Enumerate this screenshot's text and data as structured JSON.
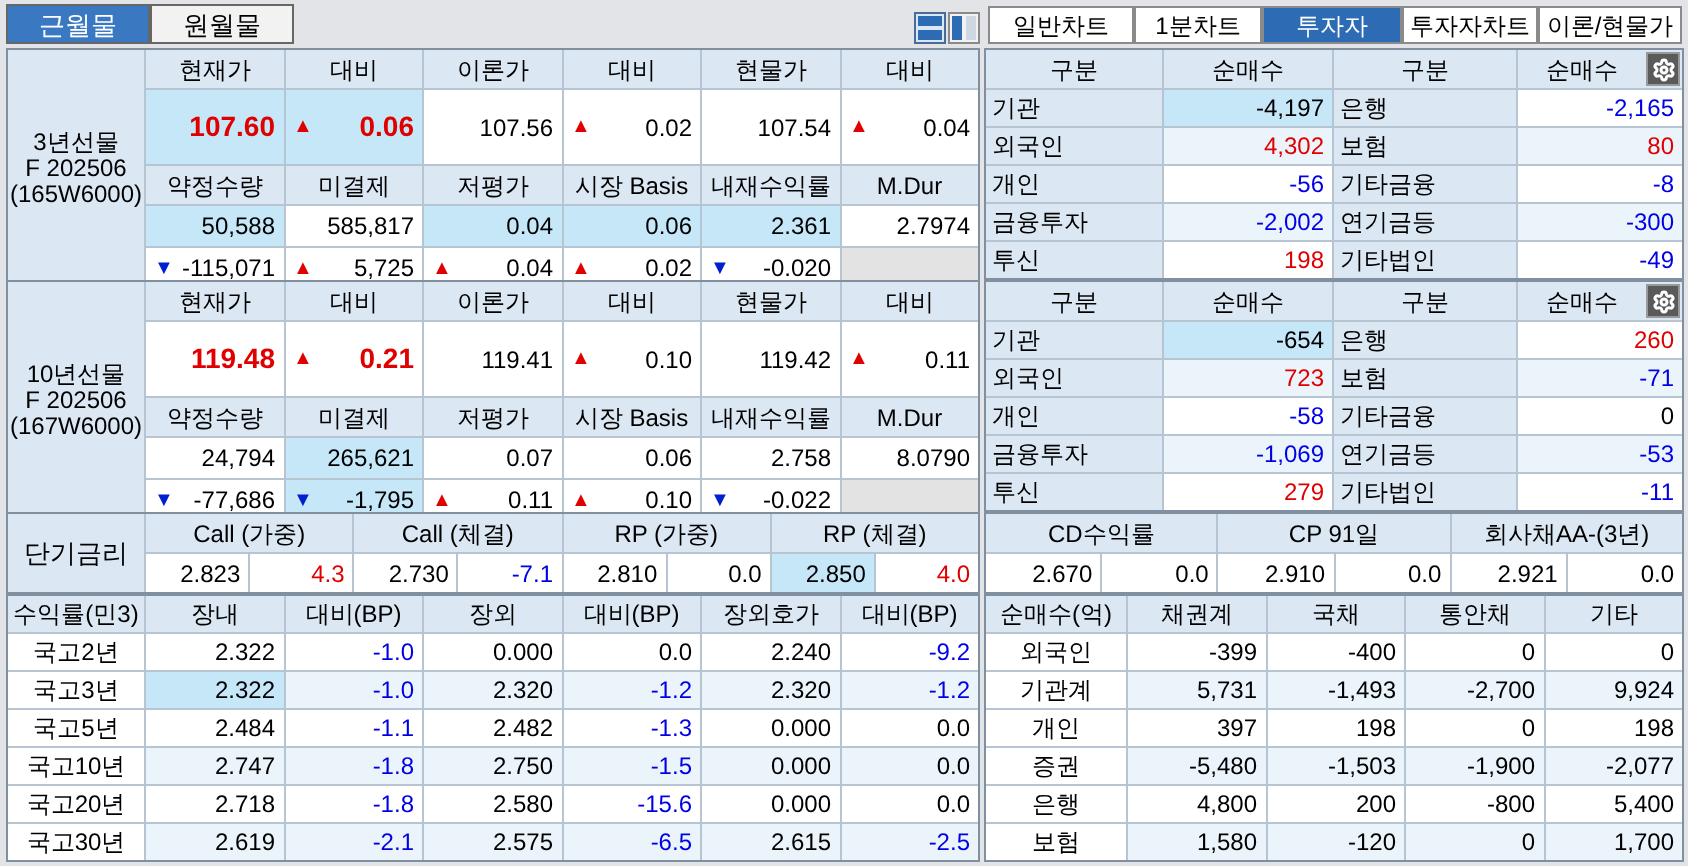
{
  "left_tabs": [
    {
      "label": "근월물",
      "selected": true
    },
    {
      "label": "원월물",
      "selected": false
    }
  ],
  "right_tabs": [
    {
      "label": "일반차트",
      "selected": false
    },
    {
      "label": "1분차트",
      "selected": false
    },
    {
      "label": "투자자",
      "selected": true
    },
    {
      "label": "투자자차트",
      "selected": false
    },
    {
      "label": "이론/현물가",
      "selected": false
    }
  ],
  "futures": [
    {
      "name": "3년선물",
      "code": "F 202506",
      "symbol": "(165W6000)",
      "top_headers": [
        "현재가",
        "대비",
        "이론가",
        "대비",
        "현물가",
        "대비"
      ],
      "top_values": [
        {
          "text": "107.60",
          "color": "#e00000",
          "highlighted": true
        },
        {
          "text": "0.06",
          "color": "#e00000",
          "arrow": {
            "text": "▲",
            "color": "#e00000"
          },
          "highlighted": true
        },
        {
          "text": "107.56"
        },
        {
          "text": "0.02",
          "arrow": {
            "text": "▲",
            "color": "#e00000"
          }
        },
        {
          "text": "107.54"
        },
        {
          "text": "0.04",
          "arrow": {
            "text": "▲",
            "color": "#e00000"
          }
        }
      ],
      "bottom_headers": [
        "약정수량",
        "미결제",
        "저평가",
        "시장 Basis",
        "내재수익률",
        "M.Dur"
      ],
      "bottom_values": [
        {
          "text": "50,588",
          "highlighted": true
        },
        {
          "text": "585,817"
        },
        {
          "text": "0.04",
          "highlighted": true
        },
        {
          "text": "0.06",
          "highlighted": true
        },
        {
          "text": "2.361",
          "highlighted": true
        },
        {
          "text": "2.7974"
        }
      ],
      "changes": [
        {
          "text": "-115,071",
          "arrow": {
            "text": "▼",
            "color": "#0020d0"
          }
        },
        {
          "text": "5,725",
          "arrow": {
            "text": "▲",
            "color": "#e00000"
          }
        },
        {
          "text": "0.04",
          "arrow": {
            "text": "▲",
            "color": "#e00000"
          }
        },
        {
          "text": "0.02",
          "arrow": {
            "text": "▲",
            "color": "#e00000"
          }
        },
        {
          "text": "-0.020",
          "arrow": {
            "text": "▼",
            "color": "#0020d0"
          }
        }
      ]
    },
    {
      "name": "10년선물",
      "code": "F 202506",
      "symbol": "(167W6000)",
      "top_headers": [
        "현재가",
        "대비",
        "이론가",
        "대비",
        "현물가",
        "대비"
      ],
      "top_values": [
        {
          "text": "119.48",
          "color": "#e00000"
        },
        {
          "text": "0.21",
          "color": "#e00000",
          "arrow": {
            "text": "▲",
            "color": "#e00000"
          }
        },
        {
          "text": "119.41"
        },
        {
          "text": "0.10",
          "arrow": {
            "text": "▲",
            "color": "#e00000"
          }
        },
        {
          "text": "119.42"
        },
        {
          "text": "0.11",
          "arrow": {
            "text": "▲",
            "color": "#e00000"
          }
        }
      ],
      "bottom_headers": [
        "약정수량",
        "미결제",
        "저평가",
        "시장 Basis",
        "내재수익률",
        "M.Dur"
      ],
      "bottom_values": [
        {
          "text": "24,794"
        },
        {
          "text": "265,621",
          "highlighted": true
        },
        {
          "text": "0.07"
        },
        {
          "text": "0.06"
        },
        {
          "text": "2.758"
        },
        {
          "text": "8.0790"
        }
      ],
      "changes": [
        {
          "text": "-77,686",
          "arrow": {
            "text": "▼",
            "color": "#0020d0"
          }
        },
        {
          "text": "-1,795",
          "arrow": {
            "text": "▼",
            "color": "#0020d0"
          },
          "highlighted": true
        },
        {
          "text": "0.11",
          "arrow": {
            "text": "▲",
            "color": "#e00000"
          }
        },
        {
          "text": "0.10",
          "arrow": {
            "text": "▲",
            "color": "#e00000"
          }
        },
        {
          "text": "-0.022",
          "arrow": {
            "text": "▼",
            "color": "#0020d0"
          }
        }
      ]
    }
  ],
  "investors": [
    {
      "headers": [
        "구분",
        "순매수",
        "구분",
        "순매수"
      ],
      "rows": [
        [
          {
            "text": "기관"
          },
          {
            "text": "-4,197",
            "highlighted": true
          },
          {
            "text": "은행"
          },
          {
            "text": "-2,165",
            "color": "#0000e6"
          }
        ],
        [
          {
            "text": "외국인"
          },
          {
            "text": "4,302",
            "color": "#e00000"
          },
          {
            "text": "보험"
          },
          {
            "text": "80",
            "color": "#e00000"
          }
        ],
        [
          {
            "text": "개인"
          },
          {
            "text": "-56",
            "color": "#0000e6"
          },
          {
            "text": "기타금융"
          },
          {
            "text": "-8",
            "color": "#0000e6"
          }
        ],
        [
          {
            "text": "금융투자"
          },
          {
            "text": "-2,002",
            "color": "#0000e6"
          },
          {
            "text": "연기금등"
          },
          {
            "text": "-300",
            "color": "#0000e6"
          }
        ],
        [
          {
            "text": "투신"
          },
          {
            "text": "198",
            "color": "#e00000"
          },
          {
            "text": "기타법인"
          },
          {
            "text": "-49",
            "color": "#0000e6"
          }
        ]
      ]
    },
    {
      "headers": [
        "구분",
        "순매수",
        "구분",
        "순매수"
      ],
      "rows": [
        [
          {
            "text": "기관"
          },
          {
            "text": "-654",
            "highlighted": true
          },
          {
            "text": "은행"
          },
          {
            "text": "260",
            "color": "#e00000"
          }
        ],
        [
          {
            "text": "외국인"
          },
          {
            "text": "723",
            "color": "#e00000"
          },
          {
            "text": "보험"
          },
          {
            "text": "-71",
            "color": "#0000e6"
          }
        ],
        [
          {
            "text": "개인"
          },
          {
            "text": "-58",
            "color": "#0000e6"
          },
          {
            "text": "기타금융"
          },
          {
            "text": "0"
          }
        ],
        [
          {
            "text": "금융투자"
          },
          {
            "text": "-1,069",
            "color": "#0000e6"
          },
          {
            "text": "연기금등"
          },
          {
            "text": "-53",
            "color": "#0000e6"
          }
        ],
        [
          {
            "text": "투신"
          },
          {
            "text": "279",
            "color": "#e00000"
          },
          {
            "text": "기타법인"
          },
          {
            "text": "-11",
            "color": "#0000e6"
          }
        ]
      ]
    }
  ],
  "short_rates": {
    "label": "단기금리",
    "items": [
      {
        "name": "Call (가중)",
        "rate": {
          "text": "2.823"
        },
        "change": {
          "text": "4.3",
          "color": "#e00000"
        }
      },
      {
        "name": "Call (체결)",
        "rate": {
          "text": "2.730"
        },
        "change": {
          "text": "-7.1",
          "color": "#0000e6"
        }
      },
      {
        "name": "RP (가중)",
        "rate": {
          "text": "2.810"
        },
        "change": {
          "text": "0.0"
        }
      },
      {
        "name": "RP (체결)",
        "rate": {
          "text": "2.850",
          "highlighted": true
        },
        "change": {
          "text": "4.0",
          "color": "#e00000"
        }
      },
      {
        "name": "CD수익률",
        "rate": {
          "text": "2.670"
        },
        "change": {
          "text": "0.0"
        }
      },
      {
        "name": "CP 91일",
        "rate": {
          "text": "2.910"
        },
        "change": {
          "text": "0.0"
        }
      },
      {
        "name": "회사채AA-(3년)",
        "rate": {
          "text": "2.921"
        },
        "change": {
          "text": "0.0"
        }
      }
    ]
  },
  "yields": {
    "headers": [
      "수익률(민3)",
      "장내",
      "대비(BP)",
      "장외",
      "대비(BP)",
      "장외호가",
      "대비(BP)"
    ],
    "rows": [
      [
        {
          "text": "국고2년"
        },
        {
          "text": "2.322"
        },
        {
          "text": "-1.0",
          "color": "#0000e6"
        },
        {
          "text": "0.000"
        },
        {
          "text": "0.0"
        },
        {
          "text": "2.240"
        },
        {
          "text": "-9.2",
          "color": "#0000e6"
        }
      ],
      [
        {
          "text": "국고3년"
        },
        {
          "text": "2.322",
          "highlighted": true
        },
        {
          "text": "-1.0",
          "color": "#0000e6"
        },
        {
          "text": "2.320"
        },
        {
          "text": "-1.2",
          "color": "#0000e6"
        },
        {
          "text": "2.320"
        },
        {
          "text": "-1.2",
          "color": "#0000e6"
        }
      ],
      [
        {
          "text": "국고5년"
        },
        {
          "text": "2.484"
        },
        {
          "text": "-1.1",
          "color": "#0000e6"
        },
        {
          "text": "2.482"
        },
        {
          "text": "-1.3",
          "color": "#0000e6"
        },
        {
          "text": "0.000"
        },
        {
          "text": "0.0"
        }
      ],
      [
        {
          "text": "국고10년"
        },
        {
          "text": "2.747"
        },
        {
          "text": "-1.8",
          "color": "#0000e6"
        },
        {
          "text": "2.750"
        },
        {
          "text": "-1.5",
          "color": "#0000e6"
        },
        {
          "text": "0.000"
        },
        {
          "text": "0.0"
        }
      ],
      [
        {
          "text": "국고20년"
        },
        {
          "text": "2.718"
        },
        {
          "text": "-1.8",
          "color": "#0000e6"
        },
        {
          "text": "2.580"
        },
        {
          "text": "-15.6",
          "color": "#0000e6"
        },
        {
          "text": "0.000"
        },
        {
          "text": "0.0"
        }
      ],
      [
        {
          "text": "국고30년"
        },
        {
          "text": "2.619"
        },
        {
          "text": "-2.1",
          "color": "#0000e6"
        },
        {
          "text": "2.575"
        },
        {
          "text": "-6.5",
          "color": "#0000e6"
        },
        {
          "text": "2.615"
        },
        {
          "text": "-2.5",
          "color": "#0000e6"
        }
      ]
    ]
  },
  "net_buying": {
    "headers": [
      "순매수(억)",
      "채권계",
      "국채",
      "통안채",
      "기타"
    ],
    "rows": [
      [
        {
          "text": "외국인"
        },
        {
          "text": "-399"
        },
        {
          "text": "-400"
        },
        {
          "text": "0"
        },
        {
          "text": "0"
        }
      ],
      [
        {
          "text": "기관계"
        },
        {
          "text": "5,731"
        },
        {
          "text": "-1,493"
        },
        {
          "text": "-2,700"
        },
        {
          "text": "9,924"
        }
      ],
      [
        {
          "text": "개인"
        },
        {
          "text": "397"
        },
        {
          "text": "198"
        },
        {
          "text": "0"
        },
        {
          "text": "198"
        }
      ],
      [
        {
          "text": "증권"
        },
        {
          "text": "-5,480"
        },
        {
          "text": "-1,503"
        },
        {
          "text": "-1,900"
        },
        {
          "text": "-2,077"
        }
      ],
      [
        {
          "text": "은행"
        },
        {
          "text": "4,800"
        },
        {
          "text": "200"
        },
        {
          "text": "-800"
        },
        {
          "text": "5,400"
        }
      ],
      [
        {
          "text": "보험"
        },
        {
          "text": "1,580"
        },
        {
          "text": "-120"
        },
        {
          "text": "0"
        },
        {
          "text": "1,700"
        }
      ]
    ]
  }
}
